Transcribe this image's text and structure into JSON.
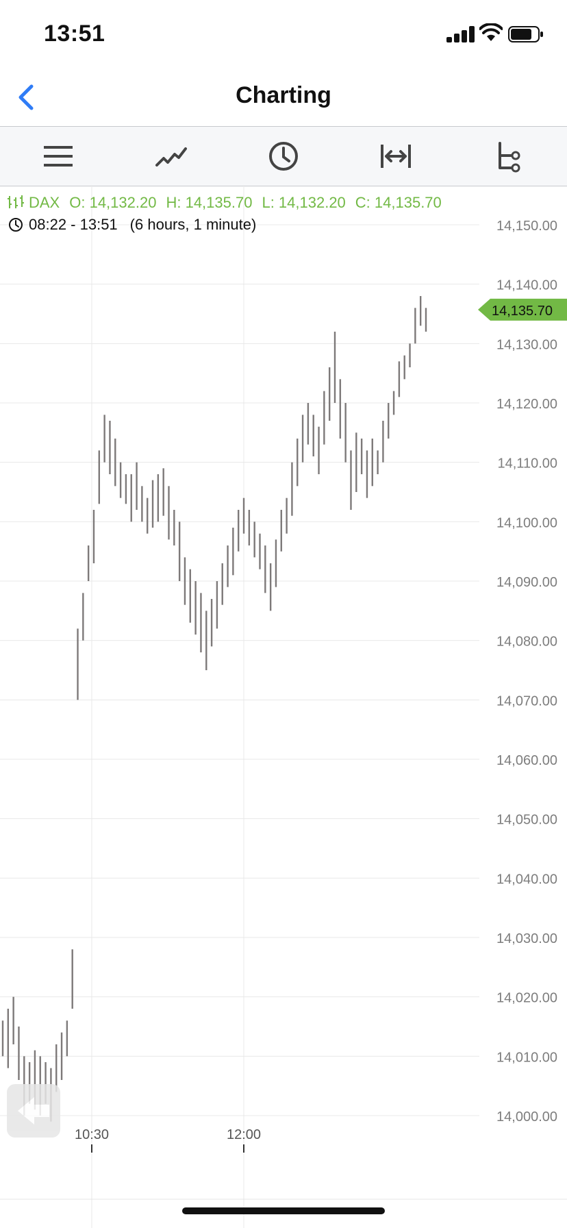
{
  "status_bar": {
    "time": "13:51"
  },
  "nav": {
    "title": "Charting"
  },
  "toolbar": {
    "items": [
      "menu-icon",
      "line-chart-icon",
      "clock-icon",
      "fit-width-icon",
      "indicator-tree-icon"
    ]
  },
  "info": {
    "symbol": "DAX",
    "open": "O: 14,132.20",
    "high": "H: 14,135.70",
    "low": "L: 14,132.20",
    "close": "C: 14,135.70",
    "time_range": "08:22 - 13:51",
    "duration": "(6 hours, 1 minute)"
  },
  "colors": {
    "accent": "#72b945",
    "candle": "#7d7979",
    "back": "#2f7cf6"
  },
  "chart_data": {
    "type": "bar",
    "instrument": "DAX",
    "ylim": [
      13995,
      14155
    ],
    "y_ticks": [
      "14,150.00",
      "14,140.00",
      "14,130.00",
      "14,120.00",
      "14,110.00",
      "14,100.00",
      "14,090.00",
      "14,080.00",
      "14,070.00",
      "14,060.00",
      "14,050.00",
      "14,040.00",
      "14,030.00",
      "14,020.00",
      "14,010.00",
      "14,000.00"
    ],
    "y_tick_values": [
      14150,
      14140,
      14130,
      14120,
      14110,
      14100,
      14090,
      14080,
      14070,
      14060,
      14050,
      14040,
      14030,
      14020,
      14010,
      14000
    ],
    "x_ticks": [
      "10:30",
      "12:00"
    ],
    "last_price": 14135.7,
    "last_price_label": "14,135.70",
    "grid": true,
    "series": [
      {
        "values": [
          [
            14010,
            14016
          ],
          [
            14008,
            14018
          ],
          [
            14012,
            14020
          ],
          [
            14006,
            14015
          ],
          [
            14000,
            14010
          ],
          [
            14002,
            14009
          ],
          [
            14001,
            14011
          ],
          [
            14000,
            14010
          ],
          [
            14002,
            14009
          ],
          [
            13999,
            14008
          ],
          [
            14004,
            14012
          ],
          [
            14006,
            14014
          ],
          [
            14010,
            14016
          ],
          [
            14018,
            14028
          ],
          [
            14070,
            14082
          ],
          [
            14080,
            14088
          ],
          [
            14090,
            14096
          ],
          [
            14093,
            14102
          ],
          [
            14103,
            14112
          ],
          [
            14110,
            14118
          ],
          [
            14108,
            14117
          ],
          [
            14106,
            14114
          ],
          [
            14104,
            14110
          ],
          [
            14103,
            14108
          ],
          [
            14100,
            14108
          ],
          [
            14102,
            14110
          ],
          [
            14100,
            14106
          ],
          [
            14098,
            14104
          ],
          [
            14099,
            14107
          ],
          [
            14100,
            14108
          ],
          [
            14101,
            14109
          ],
          [
            14097,
            14106
          ],
          [
            14096,
            14102
          ],
          [
            14090,
            14100
          ],
          [
            14086,
            14094
          ],
          [
            14083,
            14092
          ],
          [
            14081,
            14090
          ],
          [
            14078,
            14088
          ],
          [
            14075,
            14085
          ],
          [
            14079,
            14087
          ],
          [
            14082,
            14090
          ],
          [
            14086,
            14093
          ],
          [
            14089,
            14096
          ],
          [
            14091,
            14099
          ],
          [
            14095,
            14102
          ],
          [
            14098,
            14104
          ],
          [
            14096,
            14102
          ],
          [
            14094,
            14100
          ],
          [
            14092,
            14098
          ],
          [
            14088,
            14096
          ],
          [
            14085,
            14093
          ],
          [
            14089,
            14097
          ],
          [
            14095,
            14102
          ],
          [
            14098,
            14104
          ],
          [
            14101,
            14110
          ],
          [
            14106,
            14114
          ],
          [
            14110,
            14118
          ],
          [
            14113,
            14120
          ],
          [
            14111,
            14118
          ],
          [
            14108,
            14116
          ],
          [
            14113,
            14122
          ],
          [
            14117,
            14126
          ],
          [
            14120,
            14132
          ],
          [
            14114,
            14124
          ],
          [
            14110,
            14120
          ],
          [
            14102,
            14112
          ],
          [
            14105,
            14115
          ],
          [
            14108,
            14114
          ],
          [
            14104,
            14112
          ],
          [
            14106,
            14114
          ],
          [
            14108,
            14112
          ],
          [
            14110,
            14117
          ],
          [
            14114,
            14120
          ],
          [
            14118,
            14122
          ],
          [
            14121,
            14127
          ],
          [
            14124,
            14128
          ],
          [
            14126,
            14130
          ],
          [
            14130,
            14136
          ],
          [
            14133,
            14138
          ],
          [
            14132,
            14136
          ]
        ]
      }
    ]
  }
}
